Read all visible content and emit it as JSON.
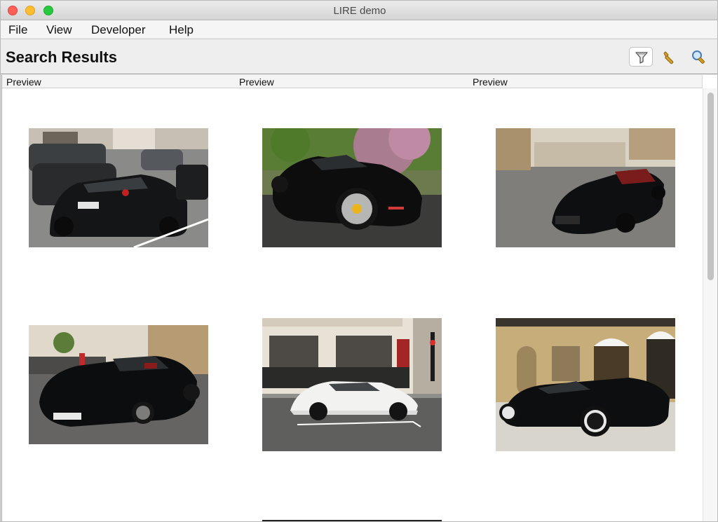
{
  "window": {
    "title": "LIRE demo"
  },
  "menu": [
    "File",
    "View",
    "Developer",
    "Help"
  ],
  "toolbar": {
    "title": "Search Results"
  },
  "icons": {
    "filter": "filter-funnel-icon",
    "settings": "wrench-icon",
    "search": "magnifier-icon"
  },
  "table": {
    "columns": [
      "Preview",
      "Preview",
      "Preview"
    ]
  },
  "results": [
    {
      "kind": "black sports car rear view on street"
    },
    {
      "kind": "black sports car under blossom tree"
    },
    {
      "kind": "black sports car in plaza"
    },
    {
      "kind": "black sports car front view with crowd"
    },
    {
      "kind": "white sports car in front of building"
    },
    {
      "kind": "black sports car in front of hotel"
    }
  ]
}
